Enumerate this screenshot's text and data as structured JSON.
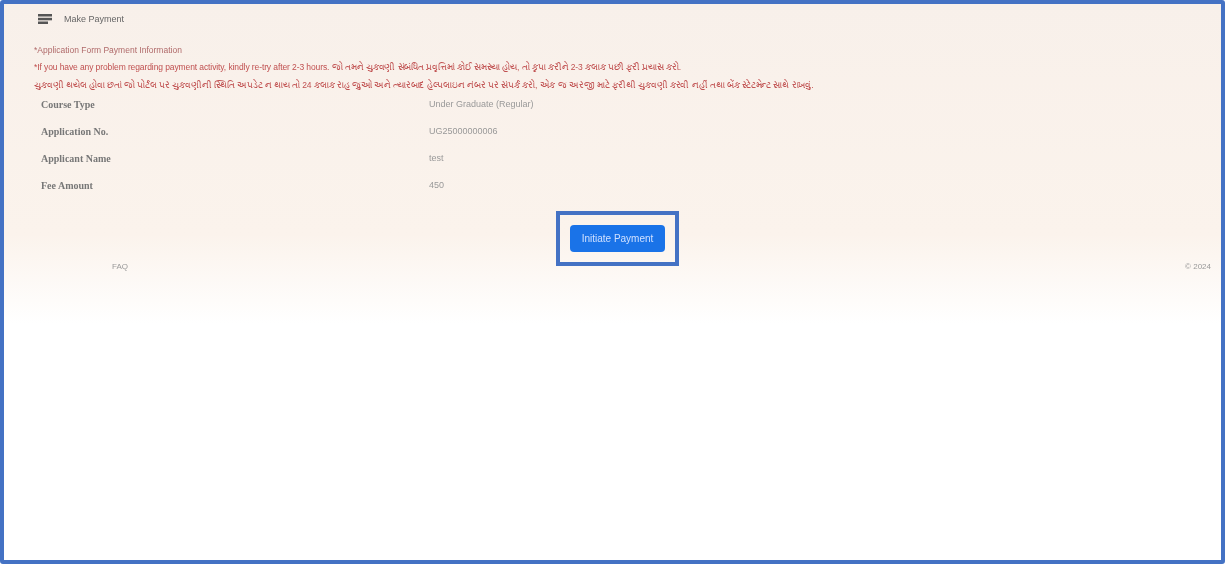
{
  "header": {
    "title": "Make Payment"
  },
  "notice": {
    "heading": "*Application Form Payment Information",
    "lines": [
      "*If you have any problem regarding payment activity, kindly re-try after 2-3 hours. જો તમને ચુકવણી સંબંધિત પ્રવૃત્તિમાં કોઈ સમસ્યા હોય, તો કૃપા કરીને 2-3 કલાક પછી ફરી પ્રયાસ કરો.",
      "ચુકવણી થયેલ હોવા છતાં જો પોર્ટલ પર ચુકવણીની સ્થિતિ અપડેટ ન થાય તો 24 કલાક રાહ જુઓ અને ત્યારબાદ હેલ્પલાઇન નંબર પર સંપર્ક કરો, એક જ અરજી માટે ફરીથી ચુકવણી કરવી નહીં તથા બેંક સ્ટેટમેન્ટ સાથે રાખવું."
    ]
  },
  "details": [
    {
      "label": "Course Type",
      "value": "Under Graduate (Regular)"
    },
    {
      "label": "Application No.",
      "value": "UG25000000006"
    },
    {
      "label": "Applicant Name",
      "value": "test"
    },
    {
      "label": "Fee Amount",
      "value": "450"
    }
  ],
  "button": {
    "label": "Initiate Payment",
    "highlighted": true
  },
  "footer": {
    "left": "FAQ",
    "right": "© 2024"
  }
}
